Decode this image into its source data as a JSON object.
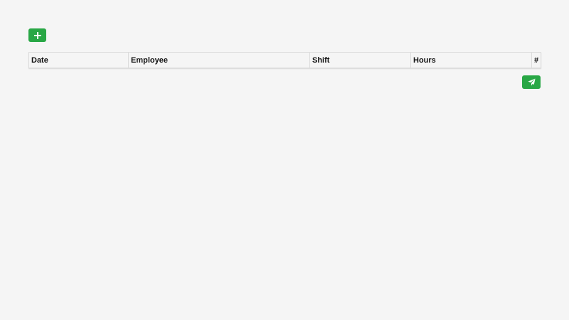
{
  "toolbar": {
    "add_icon": "plus-icon",
    "send_icon": "paper-plane-icon",
    "accent_color": "#28a745"
  },
  "table": {
    "columns": [
      "Date",
      "Employee",
      "Shift",
      "Hours",
      "#"
    ]
  }
}
